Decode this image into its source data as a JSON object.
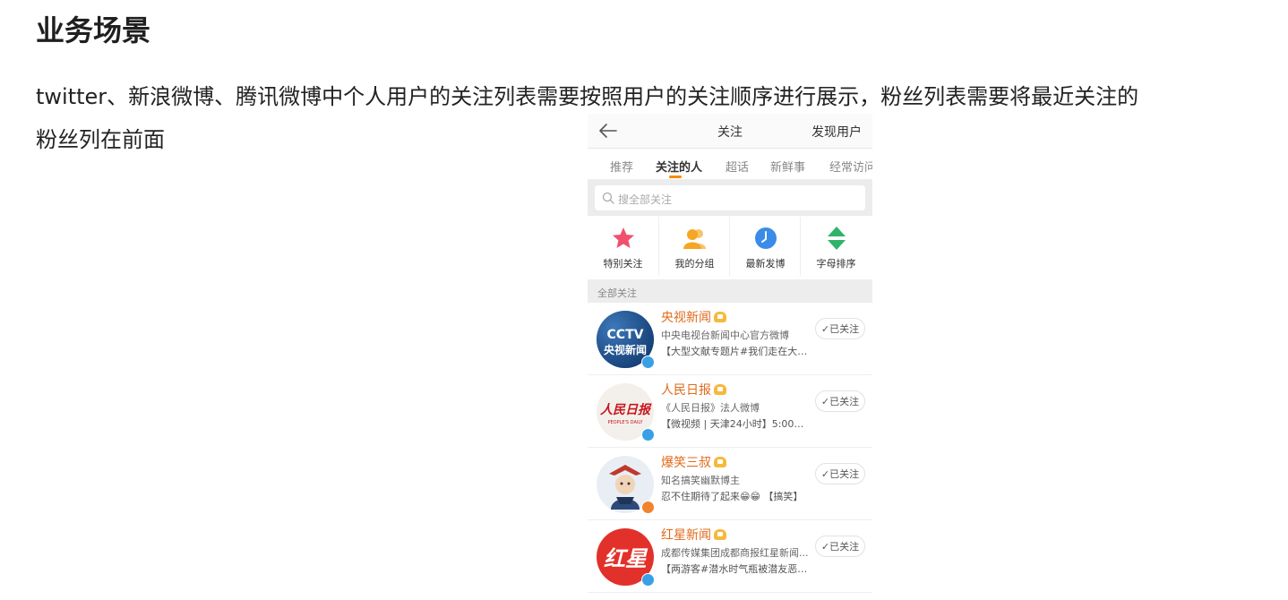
{
  "page": {
    "heading": "业务场景",
    "paragraph": "twitter、新浪微博、腾讯微博中个人用户的关注列表需要按照用户的关注顺序进行展示，粉丝列表需要将最近关注的粉丝列在前面"
  },
  "phone": {
    "header": {
      "title": "关注",
      "action": "发现用户",
      "back_icon": "arrow-left-icon"
    },
    "tabs": [
      {
        "label": "推荐"
      },
      {
        "label": "关注的人",
        "active": true
      },
      {
        "label": "超话"
      },
      {
        "label": "新鲜事"
      },
      {
        "label": "经常访问"
      }
    ],
    "search": {
      "placeholder": "搜全部关注"
    },
    "quick_actions": [
      {
        "label": "特别关注",
        "icon": "star-icon",
        "color": "#f0506e"
      },
      {
        "label": "我的分组",
        "icon": "group-icon",
        "color": "#f5a623"
      },
      {
        "label": "最新发博",
        "icon": "clock-icon",
        "color": "#3b8ce8"
      },
      {
        "label": "字母排序",
        "icon": "sort-arrows-icon",
        "color": "#2fb36b"
      }
    ],
    "section_label": "全部关注",
    "follow_list": [
      {
        "name": "央视新闻",
        "desc": "中央电视台新闻中心官方微博",
        "post": "【大型文献专题片#我们走在大路...",
        "button": "✓已关注",
        "avatar_text": "央视新闻",
        "avatar_logo": "CCTV",
        "badge_color": "#3aa0e6"
      },
      {
        "name": "人民日报",
        "desc": "《人民日报》法人微博",
        "post": "【微视频 | 天津24小时】5:00，云...",
        "button": "✓已关注",
        "avatar_text": "人民日报",
        "avatar_logo": "PEOPLE'S DAILY",
        "badge_color": "#3aa0e6"
      },
      {
        "name": "爆笑三叔",
        "desc": "知名搞笑幽默博主",
        "post": "忍不住期待了起来😁😁 【搞笑】",
        "button": "✓已关注",
        "badge_color": "#f0842d"
      },
      {
        "name": "红星新闻",
        "desc": "成都传媒集团成都商报红星新闻...",
        "post": "【两游客#潜水时气瓶被潜友恶意...",
        "button": "✓已关注",
        "avatar_text": "红星",
        "badge_color": "#3aa0e6"
      }
    ]
  }
}
